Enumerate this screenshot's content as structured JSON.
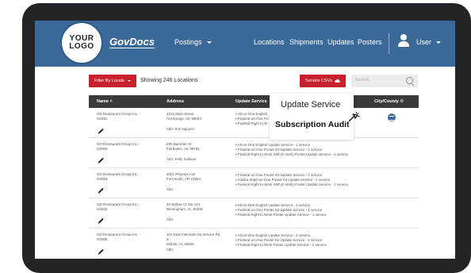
{
  "logo": {
    "line1": "YOUR",
    "line2": "LOGO"
  },
  "brand": "GovDocs",
  "nav": {
    "postings": "Postings",
    "locations": "Locations",
    "shipments": "Shipments",
    "updates": "Updates",
    "posters": "Posters",
    "user": "User"
  },
  "toolbar": {
    "filter_label": "Filter By Locale",
    "showing": "Showing 246 Locations",
    "service_csvs": "Service CSVs",
    "search_placeholder": "Search"
  },
  "table": {
    "headers": {
      "name": "Name",
      "address": "Address",
      "update_service": "Update Service",
      "city_county": "City/County"
    },
    "rows": [
      {
        "name": [
          "GD Restaurant Group Inc. -",
          "G0001"
        ],
        "address": [
          "1234 Main Street",
          "Anchorage, AK 99503",
          "",
          "Attn: Kim Nguyen"
        ],
        "services": [
          "All-on-One English",
          "Federal-on-One Po",
          "Federal Right to W"
        ]
      },
      {
        "name": [
          "GD Restaurant Group Inc. -",
          "G0002"
        ],
        "address": [
          "205 Barnette St",
          "Fairbanks, AK 99701",
          "",
          "Attn: Kelly Sullivan"
        ],
        "services": [
          "All-on-One English Update Service - 1 service",
          "Federal-on-One Poster Kit Update Service - 1 service",
          "Federal Right to Work With E-Verify Poster Update Service - 1 service"
        ]
      },
      {
        "name": [
          "GD Restaurant Group Inc. -",
          "G0003"
        ],
        "address": [
          "4001 Phoenix Ave",
          "Fort Smith, AR 72903",
          "",
          "Attn:"
        ],
        "services": [
          "Federal-on-One Poster Kit Update Service - 1 service",
          "Alaska State-on-One Poster Kit Update Service - 1 service",
          "Federal Right to Work With E-Verify Poster Update Service - 1 service"
        ]
      },
      {
        "name": [
          "GD Restaurant Group Inc. -",
          "G0004"
        ],
        "address": [
          "33 Barber Ct Ste 113",
          "Birmingham, AL 35209",
          "",
          "Attn:"
        ],
        "services": [
          "All-on-One English Update Service - 1 service",
          "Federal-on-One Poster Kit Update Service - 1 service",
          "Federal Right to Work Poster Update Service - 1 service"
        ]
      },
      {
        "name": [
          "GD Restaurant Group Inc. -",
          "G0005"
        ],
        "address": [
          "101 East Interstate 65 Service Rd",
          "S",
          "Mobile, AL 36606",
          "Attn:"
        ],
        "services": [
          "All-on-One English Update Service - 1 service",
          "Federal-on-One Poster Kit Update Service - 1 service",
          "Federal Right to Work Poster Update Service - 1 service"
        ]
      }
    ]
  },
  "popup": {
    "title": "Update Service",
    "subtitle": "Subscription Audit"
  },
  "colors": {
    "navbar": "#3b6999",
    "accent_red": "#c8202d",
    "table_header": "#3a3a3a"
  }
}
